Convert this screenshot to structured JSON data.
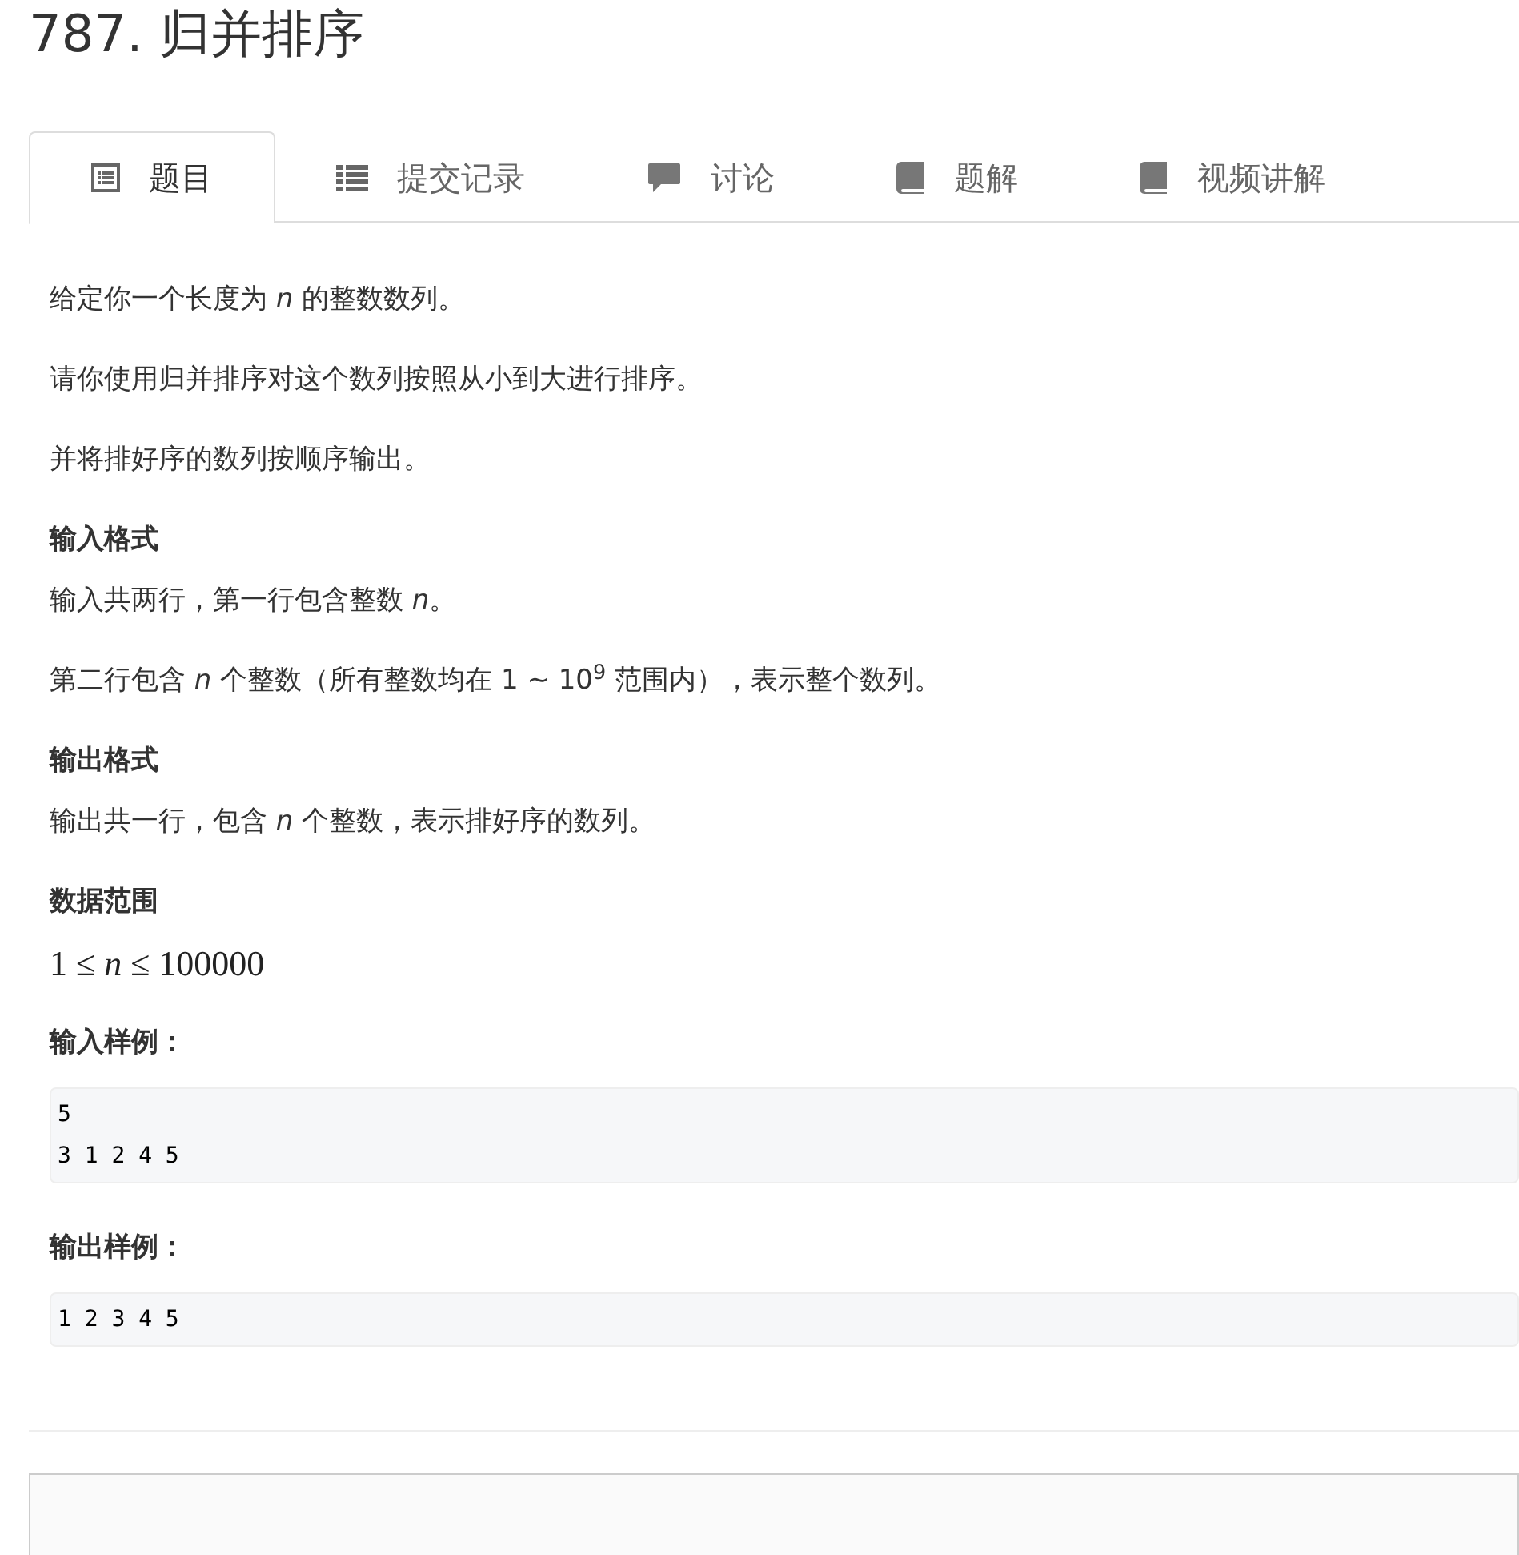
{
  "title": "787. 归并排序",
  "tabs": [
    {
      "label": "题目",
      "kind": "problem",
      "selected": true
    },
    {
      "label": "提交记录",
      "kind": "submissions",
      "selected": false
    },
    {
      "label": "讨论",
      "kind": "discussion",
      "selected": false
    },
    {
      "label": "题解",
      "kind": "solutions",
      "selected": false
    },
    {
      "label": "视频讲解",
      "kind": "video",
      "selected": false
    }
  ],
  "content": [
    {
      "kind": "paragraph",
      "text": "给定你一个长度为 *n* 的整数数列。"
    },
    {
      "kind": "paragraph",
      "text": "请你使用归并排序对这个数列按照从小到大进行排序。"
    },
    {
      "kind": "paragraph",
      "text": "并将排好序的数列按顺序输出。"
    },
    {
      "kind": "heading",
      "text": "输入格式"
    },
    {
      "kind": "paragraph",
      "text": "输入共两行，第一行包含整数 *n*。"
    },
    {
      "kind": "paragraph",
      "text": "第二行包含 *n* 个整数（所有整数均在 1 ∼ 10$^{9}$ 范围内），表示整个数列。"
    },
    {
      "kind": "heading",
      "text": "输出格式"
    },
    {
      "kind": "paragraph",
      "text": "输出共一行，包含 *n* 个整数，表示排好序的数列。"
    },
    {
      "kind": "heading",
      "text": "数据范围"
    },
    {
      "kind": "formula",
      "text": "1 ≤ *n* ≤ 100000"
    },
    {
      "kind": "heading",
      "text": "输入样例："
    },
    {
      "kind": "code",
      "text": "5\n3 1 2 4 5"
    },
    {
      "kind": "heading",
      "text": "输出样例："
    },
    {
      "kind": "code",
      "text": "1 2 3 4 5"
    }
  ]
}
